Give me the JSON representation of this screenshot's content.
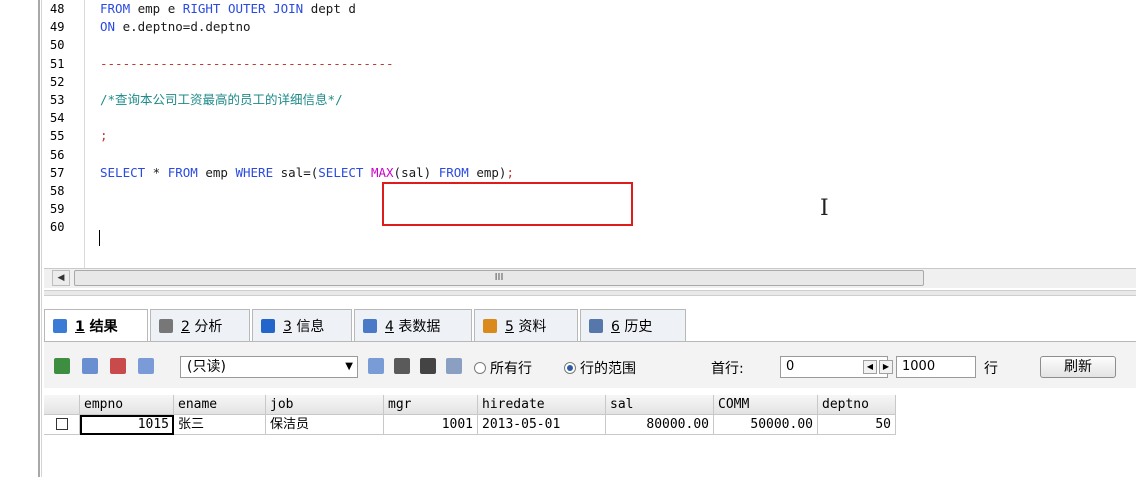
{
  "editor": {
    "lines": [
      {
        "n": "48",
        "segments": [
          {
            "t": "FROM",
            "c": "kw"
          },
          {
            "t": " emp e ",
            "c": "id"
          },
          {
            "t": "RIGHT OUTER JOIN",
            "c": "kw"
          },
          {
            "t": " dept d",
            "c": "id"
          }
        ]
      },
      {
        "n": "49",
        "segments": [
          {
            "t": "ON",
            "c": "kw"
          },
          {
            "t": " e.deptno=d.deptno",
            "c": "id"
          }
        ]
      },
      {
        "n": "50",
        "segments": []
      },
      {
        "n": "51",
        "segments": [
          {
            "t": "---------------------------------------",
            "c": "dash"
          }
        ]
      },
      {
        "n": "52",
        "segments": []
      },
      {
        "n": "53",
        "segments": [
          {
            "t": "/*查询本公司工资最高的员工的详细信息*/",
            "c": "cm"
          }
        ]
      },
      {
        "n": "54",
        "segments": []
      },
      {
        "n": "55",
        "segments": [
          {
            "t": ";",
            "c": "semi"
          }
        ]
      },
      {
        "n": "56",
        "segments": []
      },
      {
        "n": "57",
        "segments": [
          {
            "t": "SELECT",
            "c": "kw"
          },
          {
            "t": " * ",
            "c": "id"
          },
          {
            "t": "FROM",
            "c": "kw"
          },
          {
            "t": " emp ",
            "c": "id"
          },
          {
            "t": "WHERE",
            "c": "kw"
          },
          {
            "t": " sal=(",
            "c": "id"
          },
          {
            "t": "SELECT",
            "c": "kw"
          },
          {
            "t": " ",
            "c": "id"
          },
          {
            "t": "MAX",
            "c": "fn"
          },
          {
            "t": "(sal) ",
            "c": "id"
          },
          {
            "t": "FROM",
            "c": "kw"
          },
          {
            "t": " emp)",
            "c": "id"
          },
          {
            "t": ";",
            "c": "semi"
          }
        ]
      },
      {
        "n": "58",
        "segments": []
      },
      {
        "n": "59",
        "segments": []
      },
      {
        "n": "60",
        "segments": []
      }
    ],
    "scroll_thumb_label": "III"
  },
  "tabs": [
    {
      "num": "1",
      "label": "结果",
      "icon": "result-grid-icon",
      "color": "#3a7bd5",
      "active": true
    },
    {
      "num": "2",
      "label": "分析",
      "icon": "profiler-icon",
      "color": "#777777",
      "active": false
    },
    {
      "num": "3",
      "label": "信息",
      "icon": "info-icon",
      "color": "#2266cc",
      "active": false
    },
    {
      "num": "4",
      "label": "表数据",
      "icon": "table-data-icon",
      "color": "#4a79c8",
      "active": false
    },
    {
      "num": "5",
      "label": "资料",
      "icon": "info-chart-icon",
      "color": "#d98a1a",
      "active": false
    },
    {
      "num": "6",
      "label": "历史",
      "icon": "calendar-icon",
      "color": "#5577aa",
      "active": false
    }
  ],
  "toolbar": {
    "mode_select": "(只读)",
    "radio_all": "所有行",
    "radio_range": "行的范围",
    "first_row_label": "首行:",
    "first_row_value": "0",
    "row_count_value": "1000",
    "row_unit": "行",
    "refresh": "刷新"
  },
  "grid": {
    "columns": [
      "empno",
      "ename",
      "job",
      "mgr",
      "hiredate",
      "sal",
      "COMM",
      "deptno"
    ],
    "rows": [
      [
        "1015",
        "张三",
        "保洁员",
        "1001",
        "2013-05-01",
        "80000.00",
        "50000.00",
        "50"
      ]
    ]
  }
}
